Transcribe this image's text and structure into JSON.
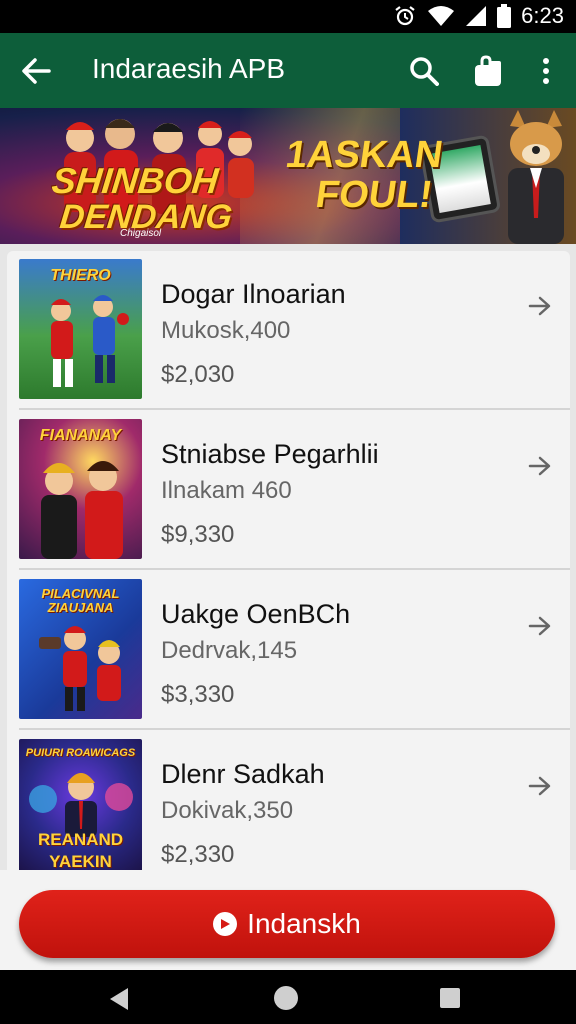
{
  "status_bar": {
    "time": "6:23",
    "icons": [
      "alarm-icon",
      "wifi-icon",
      "signal-icon",
      "battery-icon"
    ]
  },
  "app_bar": {
    "title": "Indaraesih APB",
    "icons": [
      "back-arrow-icon",
      "search-icon",
      "shopping-bag-icon",
      "more-vert-icon"
    ],
    "color": "#0d5e3a"
  },
  "banner": {
    "title_line1": "SHINBOH",
    "title_line2": "DENDANG",
    "subtitle": "Chigaisol",
    "promo_line1": "1ASKAN",
    "promo_line2": "FOUL!"
  },
  "list": {
    "items": [
      {
        "thumb_label": "THIERO",
        "thumb_label_bottom": "",
        "title": "Dogar Ilnoarian",
        "subtitle": "Mukosk,400",
        "price": "$2,030",
        "thumb_bg": "#2d8a3a"
      },
      {
        "thumb_label": "FIANANAY",
        "thumb_label_bottom": "",
        "title": "Stniabse Pegarhlii",
        "subtitle": "Ilnakam 460",
        "price": "$9,330",
        "thumb_bg": "#4a2a6e"
      },
      {
        "thumb_label": "PILACIVNAL ZIAUJANA",
        "thumb_label_bottom": "",
        "title": "Uakge OenBCh",
        "subtitle": "Dedrvak,145",
        "price": "$3,330",
        "thumb_bg": "#2a4ab0"
      },
      {
        "thumb_label": "PUIURI ROAWICAGS",
        "thumb_label_bottom": "REANAND YAEKIN",
        "title": "Dlenr Sadkah",
        "subtitle": "Dokivak,350",
        "price": "$2,330",
        "thumb_bg": "#2a2a7a"
      }
    ]
  },
  "cta": {
    "label": "Indanskh",
    "color": "#d61a14"
  },
  "nav_bar": {
    "icons": [
      "nav-back-icon",
      "nav-home-icon",
      "nav-recents-icon"
    ]
  }
}
